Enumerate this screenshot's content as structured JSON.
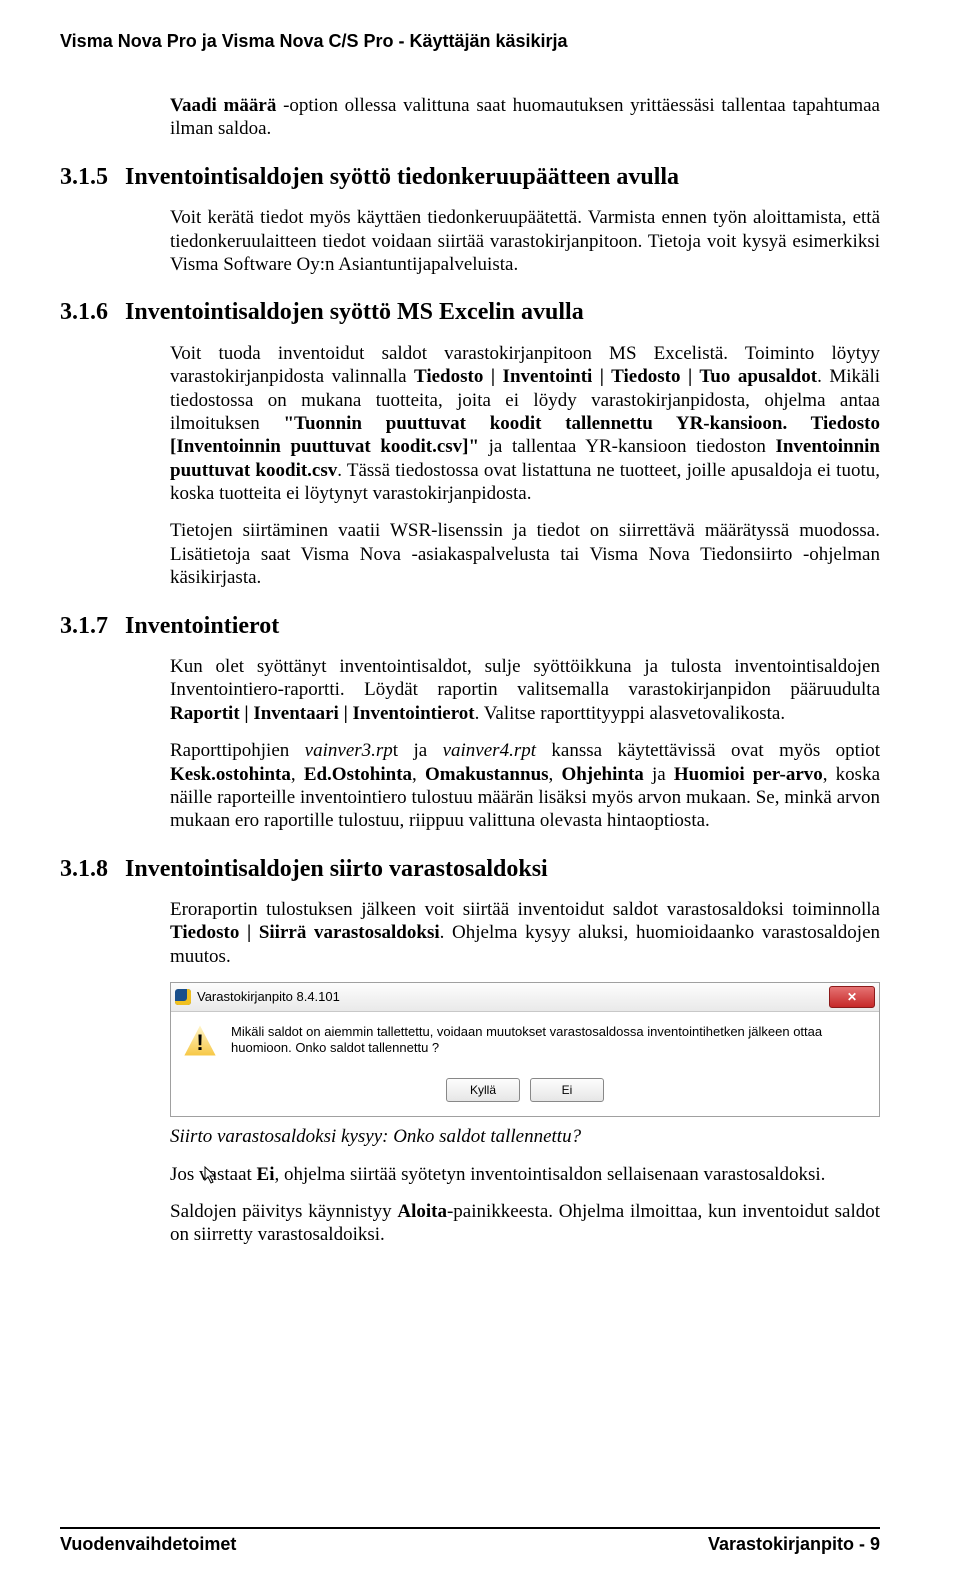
{
  "header": {
    "title": "Visma Nova Pro ja Visma Nova C/S Pro - Käyttäjän käsikirja"
  },
  "intro": {
    "p1_a": "Vaadi määrä",
    "p1_b": " -option ollessa valittuna saat huomautuksen yrittäessäsi tallentaa tapahtumaa ilman saldoa."
  },
  "s315": {
    "num": "3.1.5",
    "title": "Inventointisaldojen syöttö tiedonkeruupäätteen avulla",
    "p1": "Voit kerätä tiedot myös käyttäen tiedonkeruupäätettä. Varmista ennen työn aloittamista, että tiedonkeruulaitteen tiedot voidaan siirtää varastokirjanpitoon. Tietoja voit kysyä esimerkiksi Visma Software Oy:n Asiantuntijapalveluista."
  },
  "s316": {
    "num": "3.1.6",
    "title": "Inventointisaldojen syöttö MS Excelin avulla",
    "p1_a": "Voit tuoda inventoidut saldot varastokirjanpitoon MS Excelistä. Toiminto löytyy varastokirjanpidosta valinnalla ",
    "p1_b": "Tiedosto | Inventointi | Tiedosto | Tuo apusaldot",
    "p1_c": ". Mikäli tiedostossa on mukana tuotteita, joita ei löydy varastokirjanpidosta, ohjelma antaa ilmoituksen ",
    "p1_d": "\"Tuonnin puuttuvat koodit tallennettu YR-kansioon. Tiedosto [Inventoinnin puuttuvat koodit.csv]\"",
    "p1_e": " ja tallentaa YR-kansioon tiedoston ",
    "p1_f": "Inventoinnin puuttuvat koodit.csv",
    "p1_g": ". Tässä tiedostossa ovat listattuna ne tuotteet, joille apusaldoja ei tuotu, koska tuotteita ei löytynyt varastokirjanpidosta.",
    "p2": "Tietojen siirtäminen vaatii WSR-lisenssin ja tiedot on siirrettävä määrätyssä muodossa. Lisätietoja saat Visma Nova -asiakaspalvelusta tai Visma Nova Tiedonsiirto -ohjelman käsikirjasta."
  },
  "s317": {
    "num": "3.1.7",
    "title": "Inventointierot",
    "p1_a": "Kun olet syöttänyt inventointisaldot, sulje syöttöikkuna ja tulosta inventointisaldojen Inventointiero-raportti. Löydät raportin valitsemalla varastokirjanpidon pääruudulta ",
    "p1_b": "Raportit | Inventaari | Inventointierot",
    "p1_c": ". Valitse raporttityyppi alasvetovalikosta.",
    "p2_a": "Raporttipohjien ",
    "p2_b": "vainver3.rp",
    "p2_c": "t ja ",
    "p2_d": "vainver4.rpt",
    "p2_e": " kanssa käytettävissä ovat myös optiot ",
    "p2_f": "Kesk.ostohinta",
    "p2_g": ", ",
    "p2_h": "Ed.Ostohinta",
    "p2_i": ", ",
    "p2_j": "Omakustannus",
    "p2_k": ", ",
    "p2_l": "Ohjehinta",
    "p2_m": " ja ",
    "p2_n": "Huomioi per-arvo",
    "p2_o": ", koska näille raporteille inventointiero tulostuu määrän lisäksi myös arvon mukaan. Se, minkä arvon mukaan ero raportille tulostuu, riippuu valittuna olevasta hintaoptiosta."
  },
  "s318": {
    "num": "3.1.8",
    "title": "Inventointisaldojen siirto varastosaldoksi",
    "p1_a": "Eroraportin tulostuksen jälkeen voit siirtää inventoidut saldot varastosaldoksi toiminnolla ",
    "p1_b": "Tiedosto | Siirrä varastosaldoksi",
    "p1_c": ". Ohjelma kysyy aluksi, huomioidaanko varastosaldojen muutos.",
    "caption": "Siirto varastosaldoksi kysyy: Onko saldot tallennettu?",
    "p3_a": "Jos vastaat ",
    "p3_b": "Ei",
    "p3_c": ", ohjelma siirtää syötetyn inventointisaldon sellaisenaan varastosaldoksi.",
    "p4_a": "Saldojen päivitys käynnistyy ",
    "p4_b": "Aloita",
    "p4_c": "-painikkeesta. Ohjelma ilmoittaa, kun inventoidut saldot on siirretty varastosaldoiksi."
  },
  "dialog": {
    "title": "Varastokirjanpito 8.4.101",
    "message": "Mikäli saldot on aiemmin tallettettu, voidaan muutokset varastosaldossa inventointihetken jälkeen ottaa huomioon. Onko saldot tallennettu ?",
    "yes": "Kyllä",
    "no": "Ei"
  },
  "footer": {
    "left": "Vuodenvaihdetoimet",
    "right": "Varastokirjanpito - 9"
  }
}
